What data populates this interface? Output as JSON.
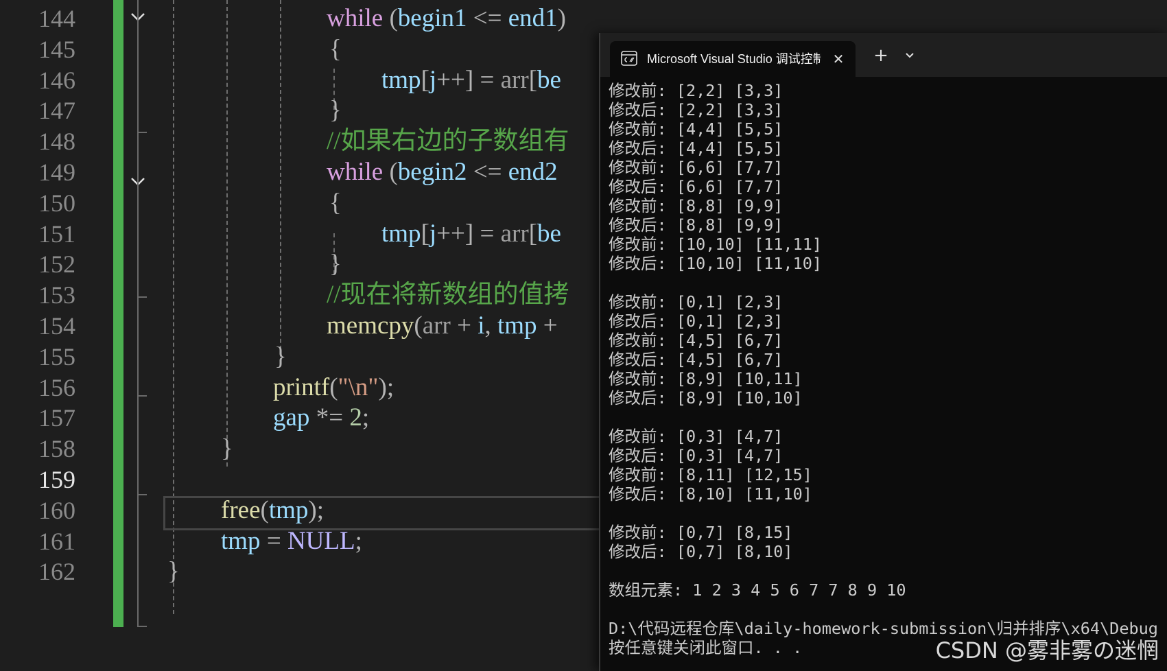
{
  "editor": {
    "line_numbers": [
      "144",
      "145",
      "146",
      "147",
      "148",
      "149",
      "150",
      "151",
      "152",
      "153",
      "154",
      "155",
      "156",
      "157",
      "158",
      "159",
      "160",
      "161",
      "162"
    ],
    "current_line": "159",
    "lines": {
      "l144": [
        "while",
        " (",
        "begin1",
        " <= ",
        "end1",
        ")"
      ],
      "l145": [
        "{"
      ],
      "l146": [
        "tmp",
        "[",
        "j",
        "++] ",
        "=",
        " ",
        "arr",
        "[",
        "be"
      ],
      "l147": [
        "}"
      ],
      "l148": [
        "//如果右边的子数组有"
      ],
      "l149": [
        "while",
        " (",
        "begin2",
        " <= ",
        "end2"
      ],
      "l150": [
        "{"
      ],
      "l151": [
        "tmp",
        "[",
        "j",
        "++] ",
        "=",
        " ",
        "arr",
        "[",
        "be"
      ],
      "l152": [
        "}"
      ],
      "l153": [
        "//现在将新数组的值拷"
      ],
      "l154": [
        "memcpy",
        "(",
        "arr",
        " + ",
        "i",
        ", ",
        "tmp",
        " +"
      ],
      "l155": [
        "}"
      ],
      "l156": [
        "printf",
        "(",
        "\"\\n\"",
        ");"
      ],
      "l157": [
        "gap",
        " *= ",
        "2",
        ";"
      ],
      "l158": [
        "}"
      ],
      "l160": [
        "free",
        "(",
        "tmp",
        ");"
      ],
      "l161": [
        "tmp",
        " = ",
        "NULL",
        ";"
      ],
      "l162": [
        "}"
      ]
    }
  },
  "console": {
    "tab_title": "Microsoft Visual Studio 调试控制台",
    "tab_close": "✕",
    "new_tab": "+",
    "lines": [
      "修改前: [2,2] [3,3]",
      "修改后: [2,2] [3,3]",
      "修改前: [4,4] [5,5]",
      "修改后: [4,4] [5,5]",
      "修改前: [6,6] [7,7]",
      "修改后: [6,6] [7,7]",
      "修改前: [8,8] [9,9]",
      "修改后: [8,8] [9,9]",
      "修改前: [10,10] [11,11]",
      "修改后: [10,10] [11,10]",
      "",
      "修改前: [0,1] [2,3]",
      "修改后: [0,1] [2,3]",
      "修改前: [4,5] [6,7]",
      "修改后: [4,5] [6,7]",
      "修改前: [8,9] [10,11]",
      "修改后: [8,9] [10,10]",
      "",
      "修改前: [0,3] [4,7]",
      "修改后: [0,3] [4,7]",
      "修改前: [8,11] [12,15]",
      "修改后: [8,10] [11,10]",
      "",
      "修改前: [0,7] [8,15]",
      "修改后: [0,7] [8,10]",
      "",
      "数组元素: 1 2 3 4 5 6 7 7 8 9 10",
      "",
      "D:\\代码远程仓库\\daily-homework-submission\\归并排序\\x64\\Debug",
      "按任意键关闭此窗口. . ."
    ]
  },
  "watermark": "CSDN @雾非雾の迷惘",
  "colors": {
    "editor_bg": "#1e1e1e",
    "console_bg": "#0c0c0c",
    "change_bar": "#4caf50",
    "keyword": "#d8a0df",
    "variable": "#9cdcfe",
    "function": "#dcdcaa",
    "comment": "#57a64a"
  },
  "icons": [
    "chevron-down-icon",
    "terminal-icon",
    "close-icon",
    "plus-icon"
  ]
}
